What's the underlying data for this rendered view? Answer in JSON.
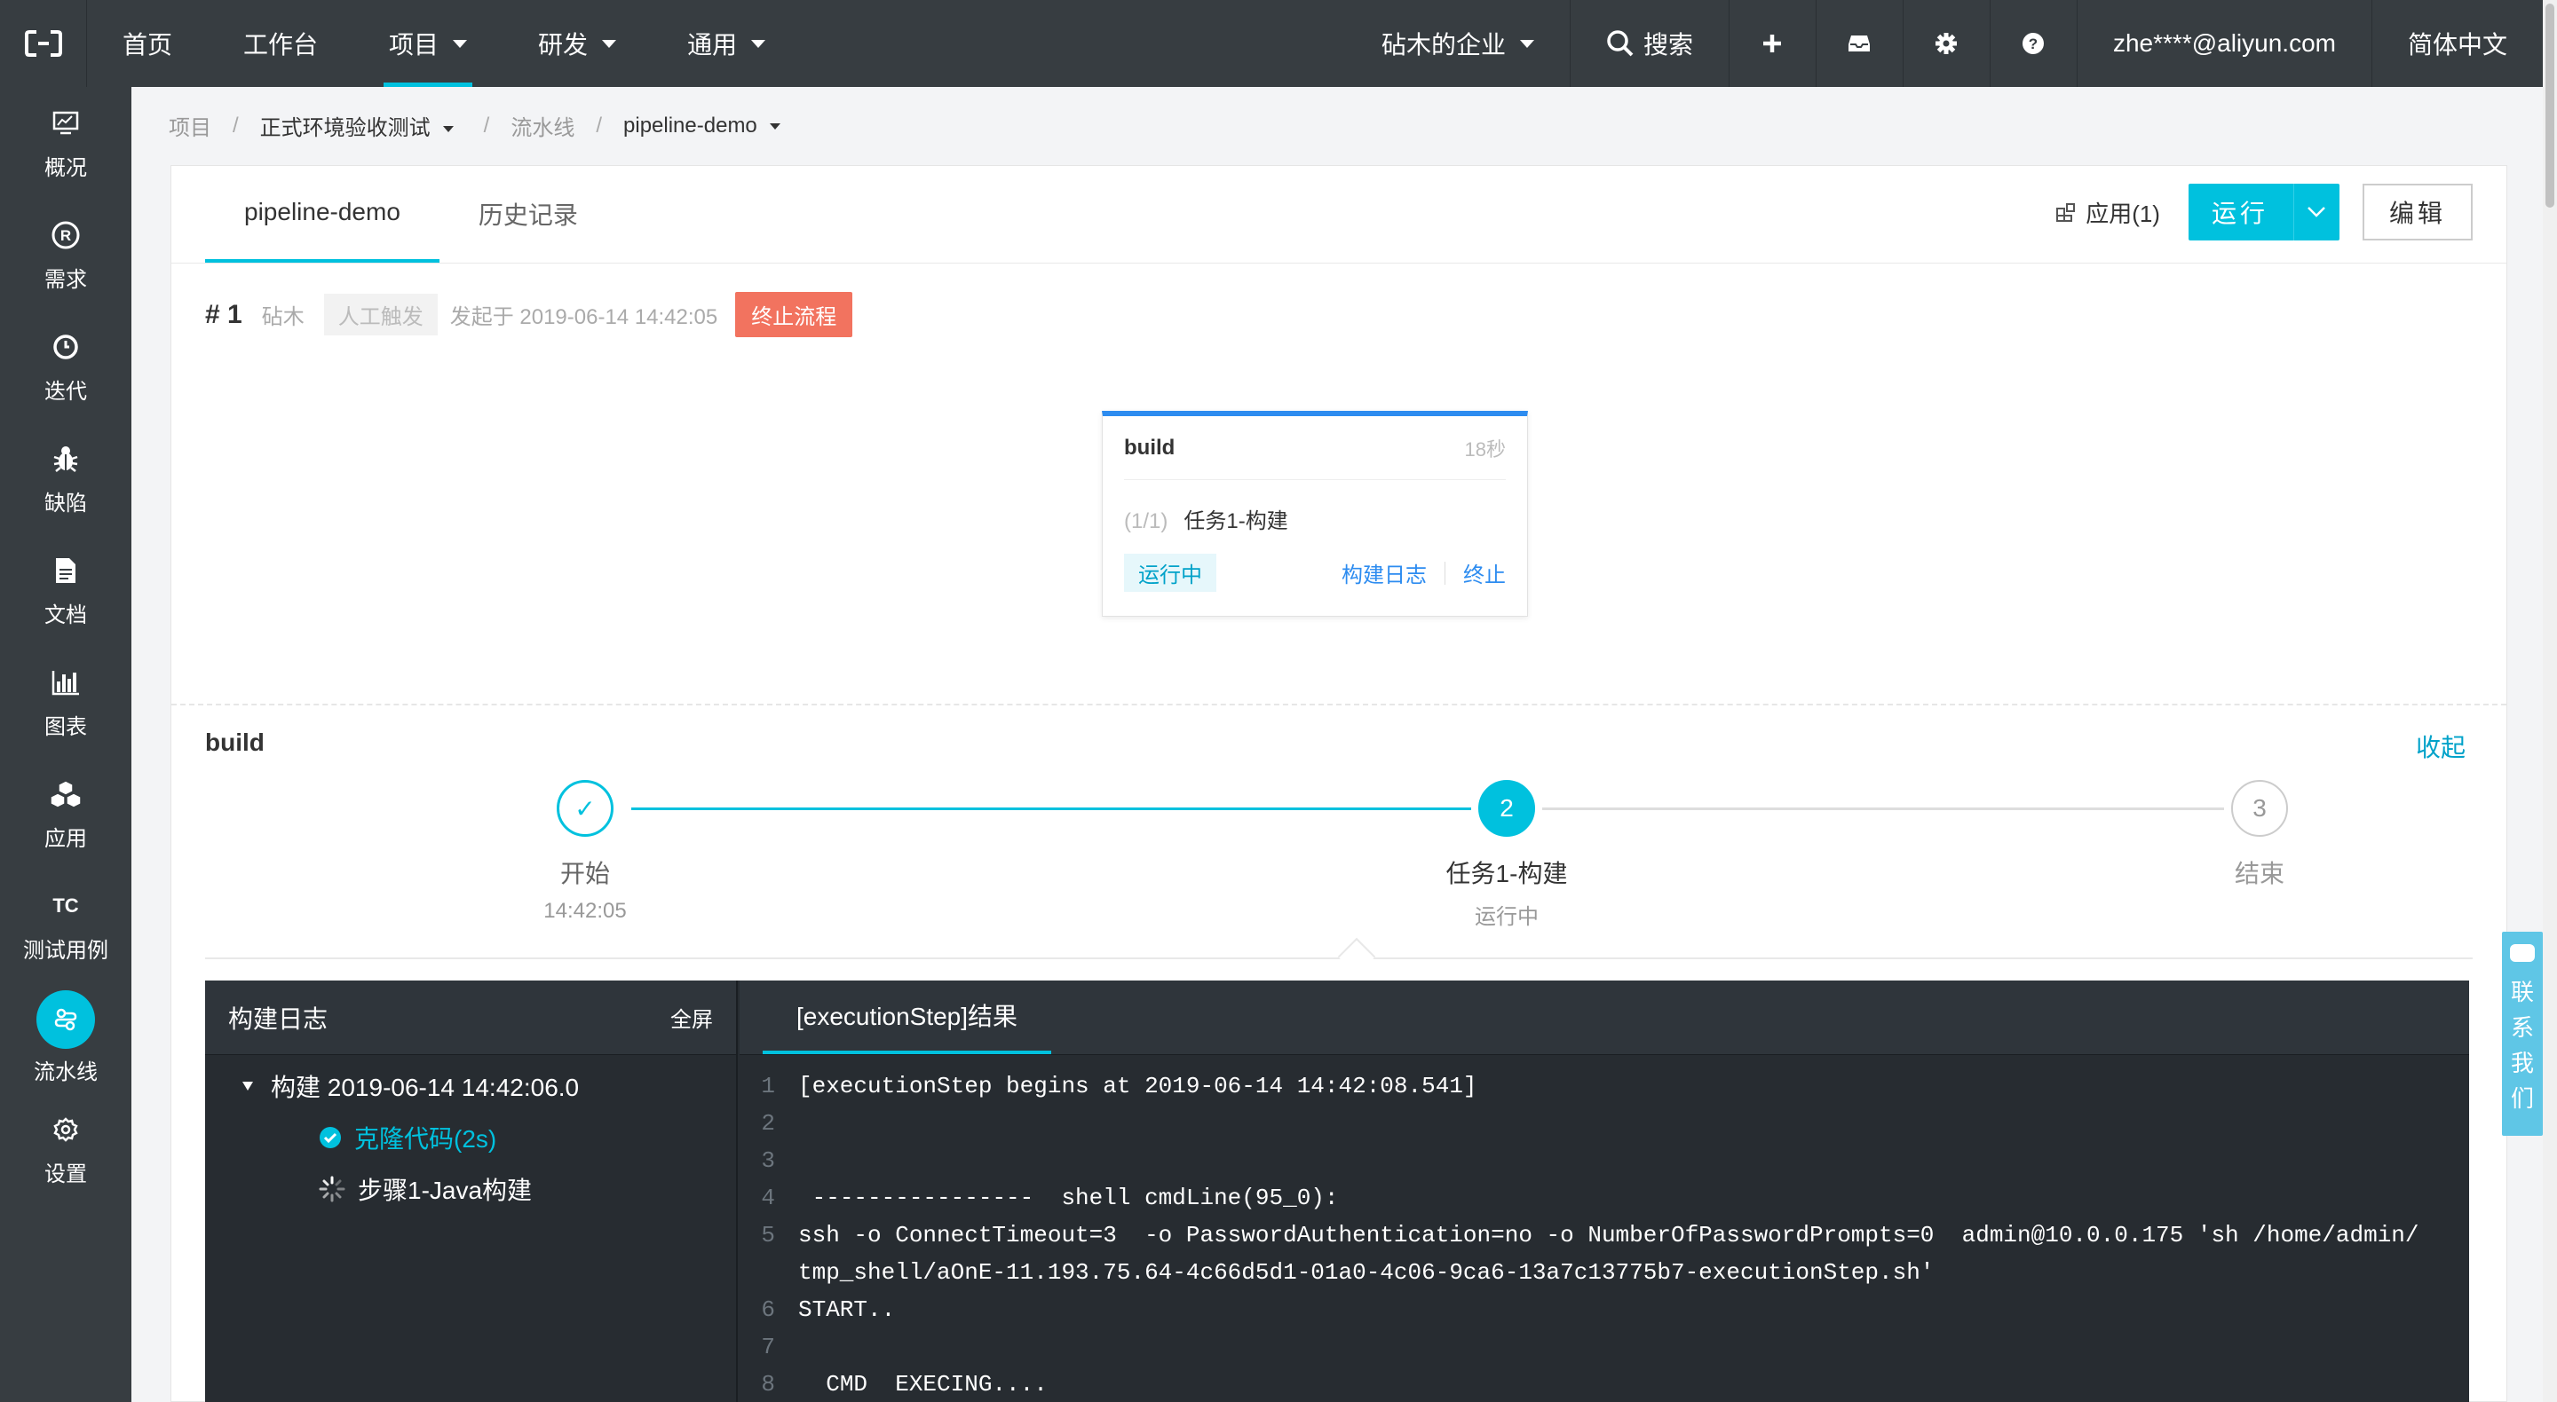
{
  "topnav": {
    "items": [
      {
        "label": "首页",
        "caret": false
      },
      {
        "label": "工作台",
        "caret": false
      },
      {
        "label": "项目",
        "caret": true
      },
      {
        "label": "研发",
        "caret": true
      },
      {
        "label": "通用",
        "caret": true
      }
    ],
    "active_index": 2,
    "enterprise": "砧木的企业",
    "search_label": "搜索",
    "user_email": "zhe****@aliyun.com",
    "language": "简体中文",
    "colors": {
      "bg": "#373d41",
      "accent": "#00c1de"
    }
  },
  "sidebar": {
    "items": [
      {
        "label": "概况",
        "icon": "monitor-chart-icon"
      },
      {
        "label": "需求",
        "icon": "r-circle-icon"
      },
      {
        "label": "迭代",
        "icon": "clock-icon"
      },
      {
        "label": "缺陷",
        "icon": "bug-icon"
      },
      {
        "label": "文档",
        "icon": "document-icon"
      },
      {
        "label": "图表",
        "icon": "bar-chart-icon"
      },
      {
        "label": "应用",
        "icon": "cubes-icon"
      },
      {
        "label": "测试用例",
        "icon": "tc-icon",
        "glyph": "TC"
      },
      {
        "label": "流水线",
        "icon": "pipeline-icon"
      },
      {
        "label": "设置",
        "icon": "gear-icon"
      }
    ],
    "active_index": 8
  },
  "breadcrumb": {
    "project_root": "项目",
    "project": "正式环境验收测试",
    "section": "流水线",
    "pipeline": "pipeline-demo"
  },
  "tabs": [
    {
      "label": "pipeline-demo"
    },
    {
      "label": "历史记录"
    }
  ],
  "actions": {
    "apps": "应用(1)",
    "run": "运行",
    "edit": "编辑"
  },
  "run_info": {
    "number": "# 1",
    "user": "砧木",
    "trigger": "人工触发",
    "started": "发起于 2019-06-14 14:42:05",
    "stop_label": "终止流程"
  },
  "stage": {
    "title": "build",
    "duration": "18秒",
    "task_index": "(1/1)",
    "task_name": "任务1-构建",
    "status": "运行中",
    "log_link": "构建日志",
    "stop_link": "终止"
  },
  "build_section": {
    "title": "build",
    "collapse": "收起"
  },
  "steps": [
    {
      "label": "开始",
      "sub": "14:42:05",
      "state": "done",
      "marker": "✓"
    },
    {
      "label": "任务1-构建",
      "sub": "运行中",
      "state": "active",
      "marker": "2"
    },
    {
      "label": "结束",
      "sub": "",
      "state": "pending",
      "marker": "3"
    }
  ],
  "log": {
    "title": "构建日志",
    "fullscreen": "全屏",
    "tree_root": "构建 2019-06-14 14:42:06.0",
    "tree_children": [
      {
        "label": "克隆代码(2s)",
        "state": "done"
      },
      {
        "label": "步骤1-Java构建",
        "state": "running"
      }
    ],
    "tab": "[executionStep]结果",
    "lines": [
      "[executionStep begins at 2019-06-14 14:42:08.541]",
      "",
      "",
      " ----------------  shell cmdLine(95_0):",
      "ssh -o ConnectTimeout=3  -o PasswordAuthentication=no -o NumberOfPasswordPrompts=0  admin@10.0.0.175 'sh /home/admin/tmp_shell/aOnE-11.193.75.64-4c66d5d1-01a0-4c06-9ca6-13a7c13775b7-executionStep.sh'",
      "START..",
      "",
      "  CMD  EXECING...."
    ]
  },
  "contact": [
    "联",
    "系",
    "我",
    "们"
  ]
}
